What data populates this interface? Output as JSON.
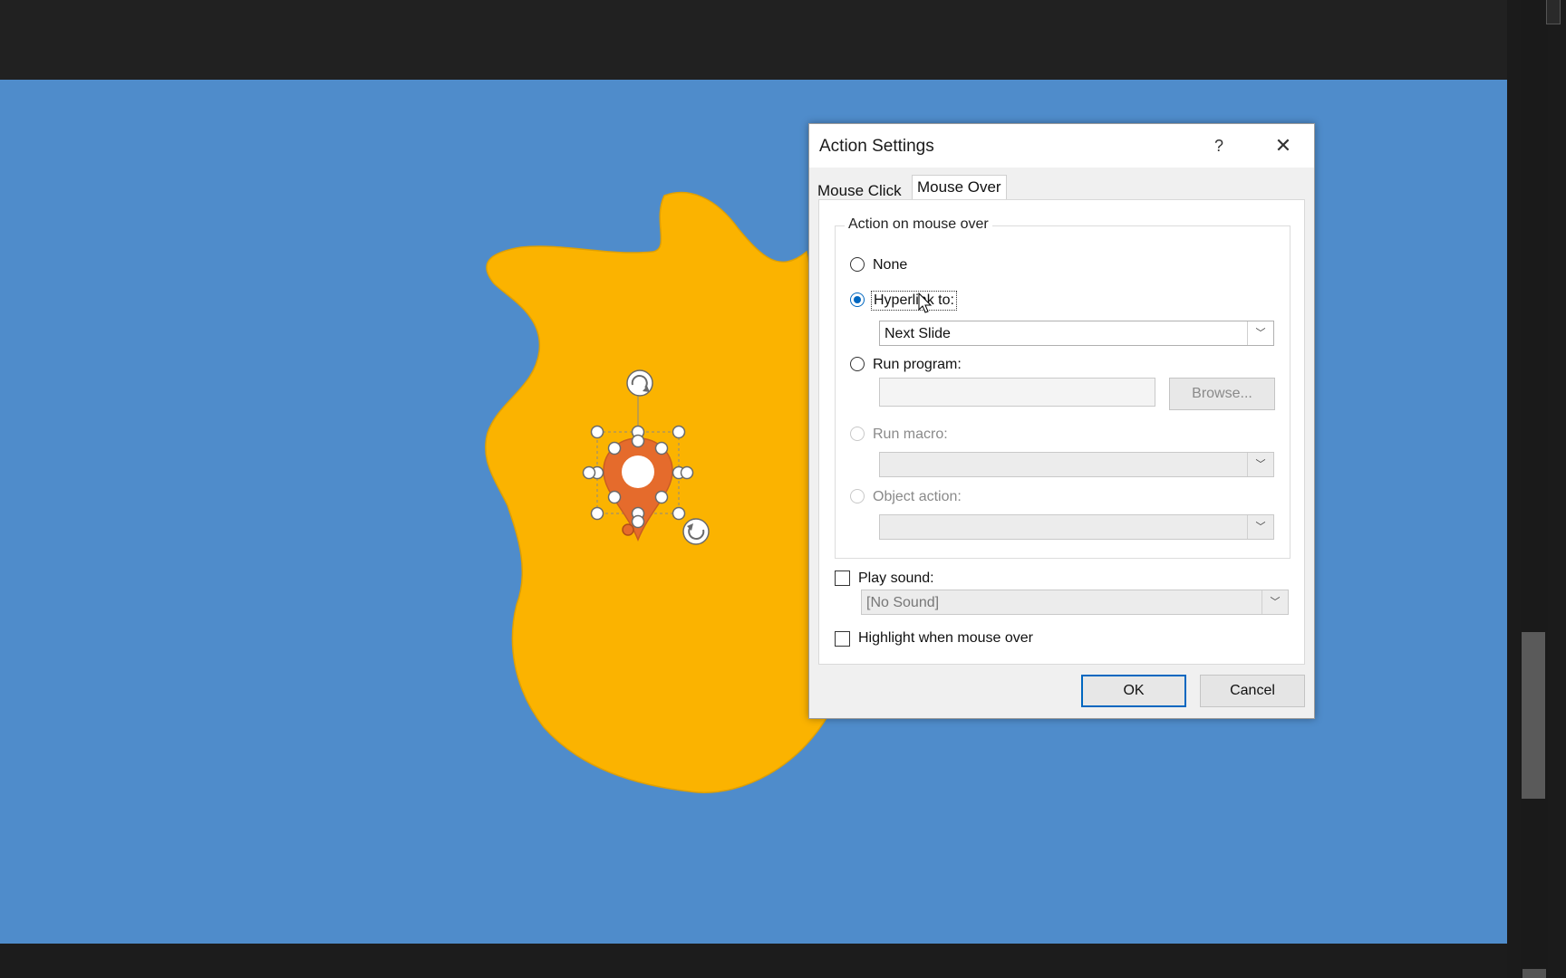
{
  "dialog": {
    "title": "Action Settings",
    "help_label": "?",
    "close_label": "✕",
    "tabs": [
      {
        "label": "Mouse Click",
        "active": false
      },
      {
        "label": "Mouse Over",
        "active": true
      }
    ],
    "group_label": "Action on mouse over",
    "options": {
      "none": "None",
      "hyperlink": "Hyperlink to:",
      "run_program": "Run program:",
      "run_macro": "Run macro:",
      "object_action": "Object action:"
    },
    "selected_option": "hyperlink",
    "hyperlink_value": "Next Slide",
    "program_value": "",
    "browse_label": "Browse...",
    "macro_value": "",
    "object_action_value": "",
    "play_sound_label": "Play sound:",
    "play_sound_checked": false,
    "sound_value": "[No Sound]",
    "highlight_label": "Highlight when mouse over",
    "highlight_checked": false,
    "ok_label": "OK",
    "cancel_label": "Cancel"
  },
  "colors": {
    "slide_bg": "#4f8ccb",
    "blob": "#fbb300",
    "pin": "#e56b2c",
    "accent": "#0067c0"
  },
  "icons": {
    "close": "close-icon",
    "dropdown": "chevron-down-icon",
    "rotate": "rotate-handle-icon",
    "cursor": "mouse-pointer-icon"
  }
}
